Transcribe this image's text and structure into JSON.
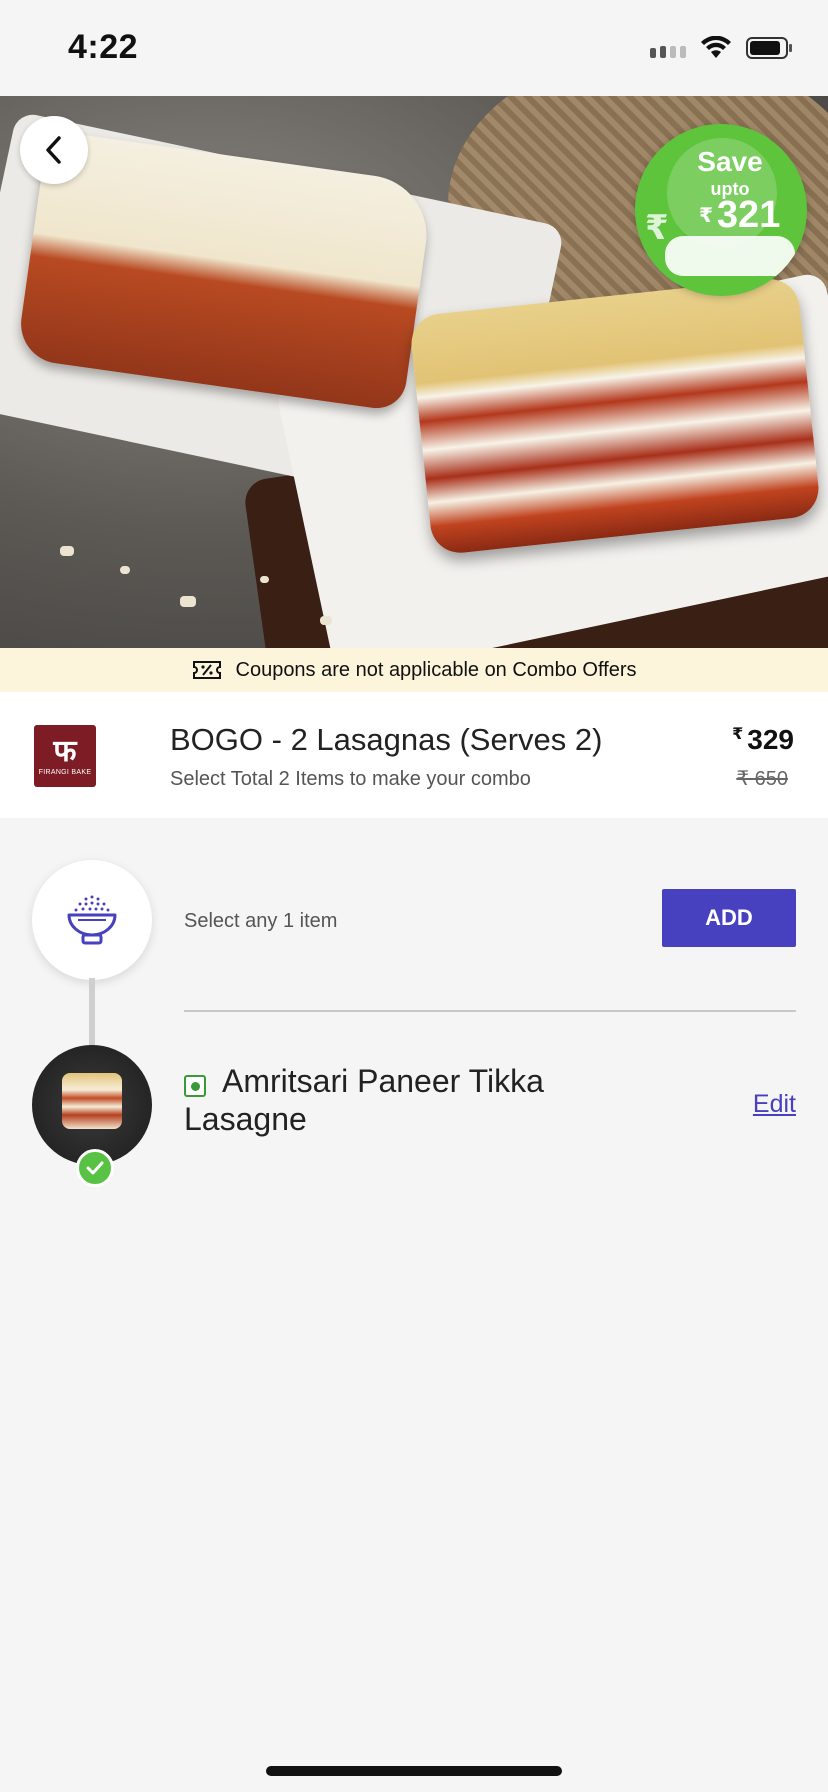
{
  "status_bar": {
    "time": "4:22"
  },
  "hero": {
    "save_badge": {
      "label": "Save",
      "sub": "upto",
      "currency": "₹",
      "amount": "321"
    }
  },
  "coupon_banner": {
    "text": "Coupons are not applicable on Combo Offers"
  },
  "product": {
    "brand_mark": "फ",
    "brand_name": "FIRANGI BAKE",
    "title": "BOGO - 2 Lasagnas (Serves 2)",
    "subtitle": "Select Total 2 Items to make your combo",
    "currency": "₹",
    "price": "329",
    "mrp": "₹ 650"
  },
  "steps": {
    "select_label": "Select any 1 item",
    "add_label": "ADD",
    "selected_item": {
      "name": "Amritsari Paneer Tikka Lasagne",
      "edit_label": "Edit"
    }
  },
  "colors": {
    "accent": "#4841bf",
    "badge_green": "#5ec43c",
    "banner_bg": "#fcf5dc",
    "brand": "#7d1c24"
  }
}
